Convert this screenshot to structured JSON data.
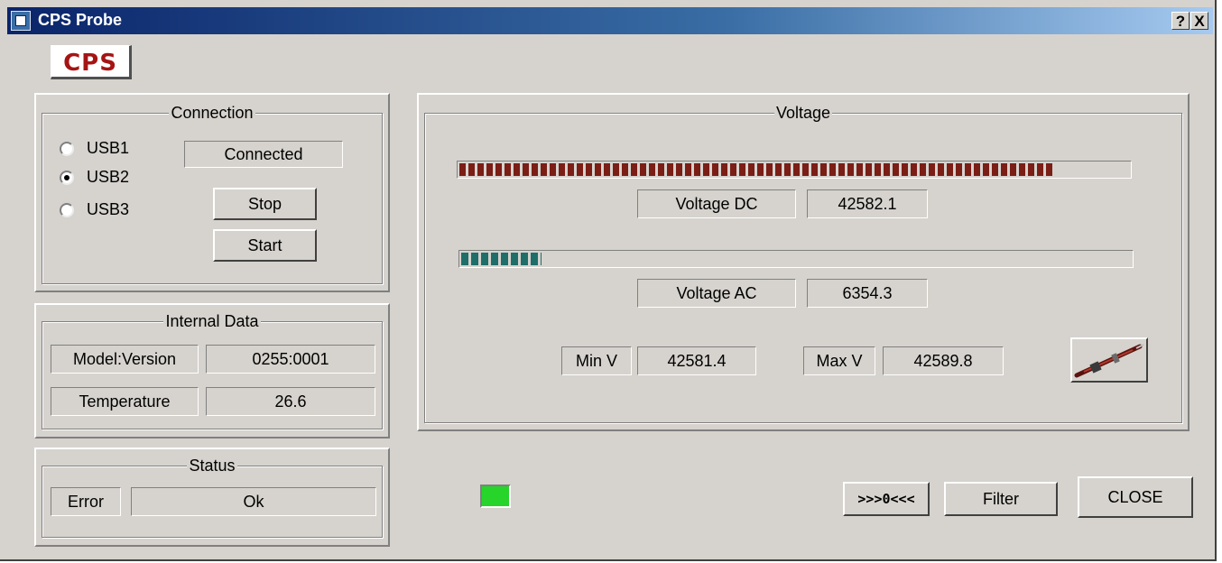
{
  "window": {
    "title": "CPS Probe",
    "help_label": "?",
    "close_label": "X"
  },
  "logo": {
    "text": "CPS"
  },
  "connection": {
    "title": "Connection",
    "options": [
      {
        "label": "USB1",
        "checked": false
      },
      {
        "label": "USB2",
        "checked": true
      },
      {
        "label": "USB3",
        "checked": false
      }
    ],
    "status": "Connected",
    "stop_label": "Stop",
    "start_label": "Start"
  },
  "internal_data": {
    "title": "Internal Data",
    "model_label": "Model:Version",
    "model_value": "0255:0001",
    "temp_label": "Temperature",
    "temp_value": "26.6"
  },
  "status": {
    "title": "Status",
    "error_label": "Error",
    "error_value": "Ok"
  },
  "voltage": {
    "title": "Voltage",
    "dc_label": "Voltage DC",
    "dc_value": "42582.1",
    "dc_level": 0.89,
    "ac_label": "Voltage AC",
    "ac_value": "6354.3",
    "ac_level": 0.12,
    "min_label": "Min V",
    "min_value": "42581.4",
    "max_label": "Max V",
    "max_value": "42589.8"
  },
  "footer": {
    "zero_label": ">>>0<<<",
    "filter_label": "Filter",
    "close_label": "CLOSE"
  },
  "colors": {
    "dc_bar": "#7a1e16",
    "ac_bar": "#1f6e6a",
    "led": "#26d42a",
    "title_bar": "#0a246a"
  },
  "icons": {
    "probe": "probe-icon",
    "app": "app-icon",
    "led": "status-led"
  }
}
